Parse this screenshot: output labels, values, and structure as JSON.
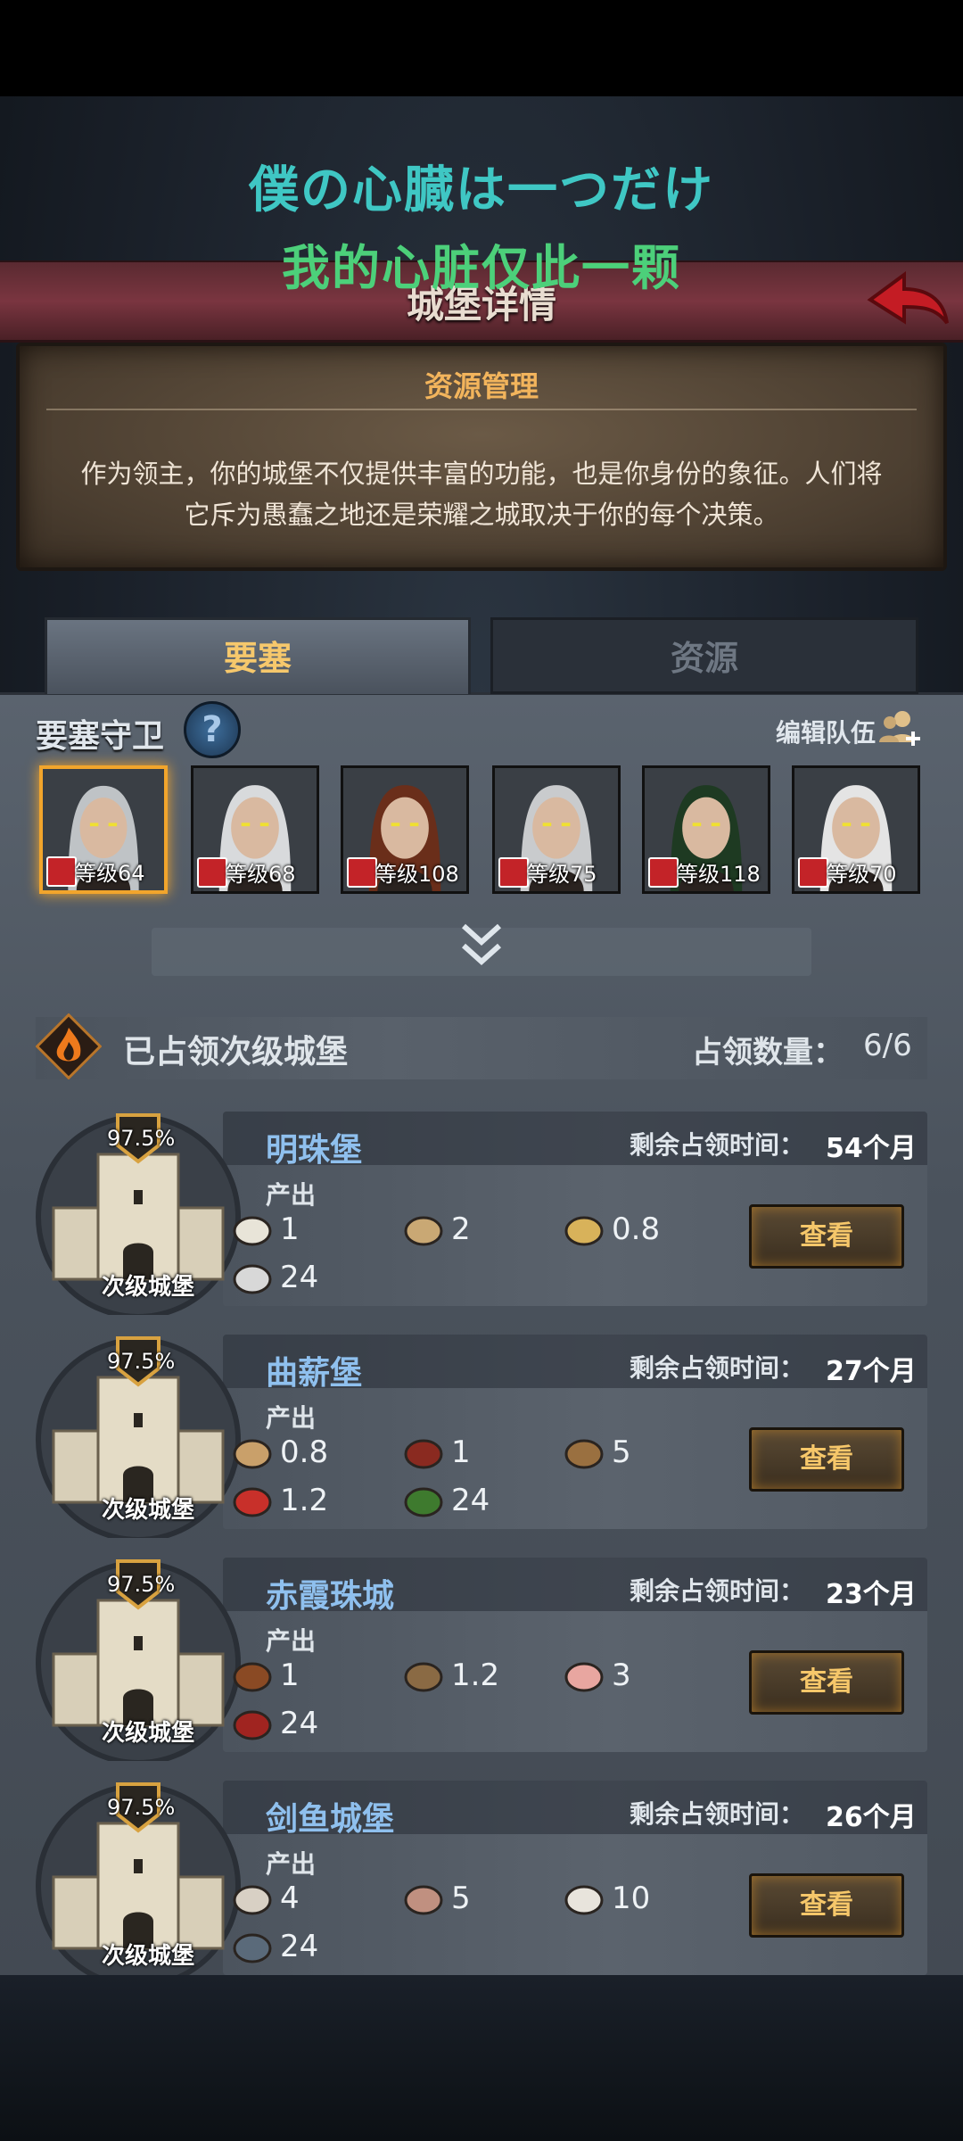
{
  "overlay": {
    "caption_jp": "僕の心臓は一つだけ",
    "caption_cn": "我的心脏仅此一颗"
  },
  "header": {
    "title": "城堡详情"
  },
  "info": {
    "title": "资源管理",
    "body_line1": "作为领主，你的城堡不仅提供丰富的功能，也是你身份的象征。人们将",
    "body_line2": "它斥为愚蠢之地还是荣耀之城取决于你的每个决策。"
  },
  "tabs": [
    {
      "label": "要塞",
      "active": true
    },
    {
      "label": "资源",
      "active": false
    }
  ],
  "guards": {
    "label": "要塞守卫",
    "help": "?",
    "edit_label": "编辑队伍",
    "heroes": [
      {
        "level": "等级64",
        "selected": true,
        "hair": "#bfc3c6"
      },
      {
        "level": "等级68",
        "selected": false,
        "hair": "#d8dadc"
      },
      {
        "level": "等级108",
        "selected": false,
        "hair": "#6a2e1a"
      },
      {
        "level": "等级75",
        "selected": false,
        "hair": "#c9cbcd"
      },
      {
        "level": "等级118",
        "selected": false,
        "hair": "#1e3a22"
      },
      {
        "level": "等级70",
        "selected": false,
        "hair": "#e4e4e4"
      }
    ]
  },
  "occupied": {
    "title": "已占领次级城堡",
    "count_label": "占领数量：",
    "count": "6/6"
  },
  "castles": [
    {
      "name": "明珠堡",
      "percent": "97.5%",
      "type": "次级城堡",
      "remain_label": "剩余占领时间：",
      "remain": "54个月",
      "produce_label": "产出",
      "resources": [
        {
          "icon": "pearl-pile-icon",
          "value": "1"
        },
        {
          "icon": "sack-icon",
          "value": "2"
        },
        {
          "icon": "goblet-icon",
          "value": "0.8"
        },
        {
          "icon": "banner-icon",
          "value": "24"
        }
      ],
      "button": "查看"
    },
    {
      "name": "曲薪堡",
      "percent": "97.5%",
      "type": "次级城堡",
      "remain_label": "剩余占领时间：",
      "remain": "27个月",
      "produce_label": "产出",
      "resources": [
        {
          "icon": "log-icon",
          "value": "0.8"
        },
        {
          "icon": "timber-icon",
          "value": "1"
        },
        {
          "icon": "planks-icon",
          "value": "5"
        },
        {
          "icon": "berries-icon",
          "value": "1.2"
        },
        {
          "icon": "tree-banner-icon",
          "value": "24"
        }
      ],
      "button": "查看"
    },
    {
      "name": "赤霞珠城",
      "percent": "97.5%",
      "type": "次级城堡",
      "remain_label": "剩余占领时间：",
      "remain": "23个月",
      "produce_label": "产出",
      "resources": [
        {
          "icon": "cow-icon",
          "value": "1"
        },
        {
          "icon": "horse-icon",
          "value": "1.2"
        },
        {
          "icon": "pig-icon",
          "value": "3"
        },
        {
          "icon": "red-banner-icon",
          "value": "24"
        }
      ],
      "button": "查看"
    },
    {
      "name": "剑鱼城堡",
      "percent": "97.5%",
      "type": "次级城堡",
      "remain_label": "剩余占领时间：",
      "remain": "26个月",
      "produce_label": "产出",
      "resources": [
        {
          "icon": "oyster-icon",
          "value": "4"
        },
        {
          "icon": "fish-icon",
          "value": "5"
        },
        {
          "icon": "salt-icon",
          "value": "10"
        },
        {
          "icon": "fish-banner-icon",
          "value": "24"
        }
      ],
      "button": "查看"
    }
  ]
}
